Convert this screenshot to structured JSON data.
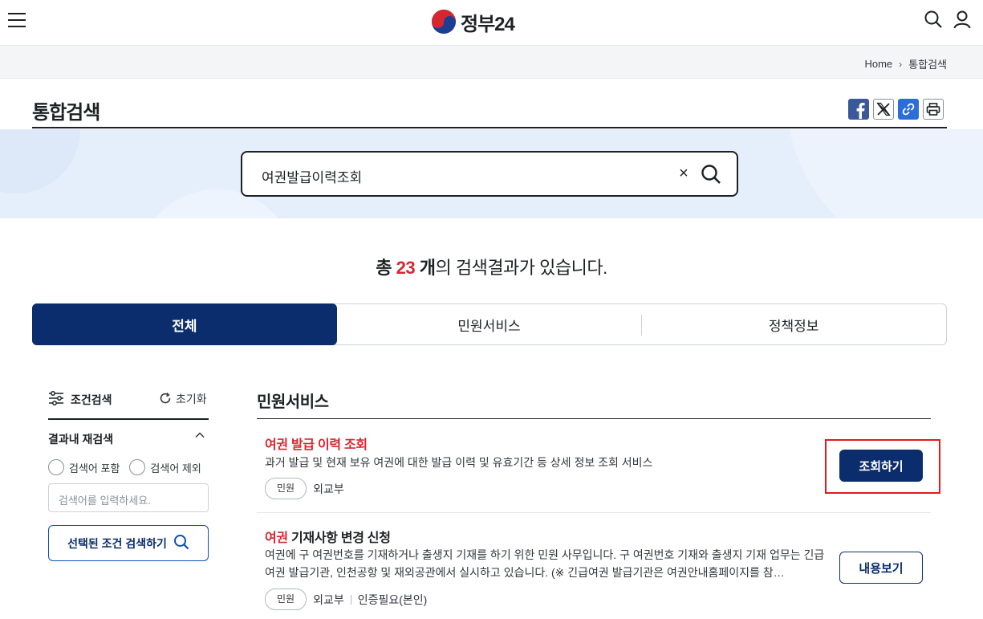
{
  "header": {
    "logo_text": "정부24",
    "menu_icon": "hamburger-menu-icon",
    "search_icon": "search-icon",
    "user_icon": "user-icon"
  },
  "breadcrumb": {
    "home": "Home",
    "current": "통합검색"
  },
  "page": {
    "title": "통합검색",
    "share": [
      "facebook-icon",
      "x-icon",
      "link-icon",
      "print-icon"
    ]
  },
  "search": {
    "query": "여권발급이력조회",
    "clear": "×"
  },
  "summary": {
    "prefix": "총",
    "count": "23",
    "unit": "개",
    "suffix": "의 검색결과가 있습니다."
  },
  "tabs": [
    {
      "label": "전체",
      "active": true
    },
    {
      "label": "민원서비스",
      "active": false
    },
    {
      "label": "정책정보",
      "active": false
    }
  ],
  "filter": {
    "title": "조건검색",
    "reset": "초기화",
    "refine_title": "결과내 재검색",
    "include": "검색어 포함",
    "exclude": "검색어 제외",
    "input_placeholder": "검색어를 입력하세요.",
    "apply": "선택된 조건 검색하기"
  },
  "section": {
    "title": "민원서비스"
  },
  "results": [
    {
      "title": "여권 발급 이력 조회",
      "desc": "과거 발급 및 현재 보유 여권에 대한 발급 이력 및 유효기간 등 상세 정보 조회 서비스",
      "tag": "민원",
      "org": "외교부",
      "button": "조회하기"
    },
    {
      "title_hl": "여권",
      "title_rest": " 기재사항 변경 신청",
      "desc": "여권에 구 여권번호를 기재하거나 출생지 기재를 하기 위한 민원 사무입니다. 구 여권번호 기재와 출생지 기재 업무는 긴급여권 발급기관, 인천공항 및 재외공관에서 실시하고 있습니다. (※ 긴급여권 발급기관은 여권안내홈페이지를 참…",
      "tag": "민원",
      "org": "외교부",
      "extra": "인증필요(본인)",
      "button": "내용보기"
    }
  ],
  "colors": {
    "navy": "#0b2d6e",
    "red": "#d8262e",
    "banner": "#e5eefb"
  }
}
